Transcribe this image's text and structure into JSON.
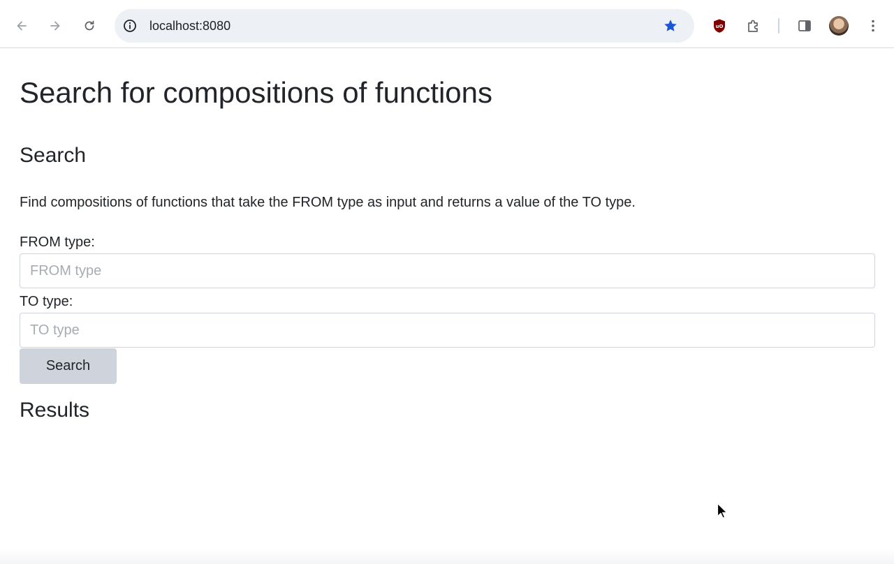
{
  "browser": {
    "url": "localhost:8080",
    "icons": {
      "back": "arrow-left-icon",
      "forward": "arrow-right-icon",
      "reload": "reload-icon",
      "site_info": "info-icon",
      "bookmark": "star-icon",
      "extension_ublock": "ublock-origin-icon",
      "extensions": "puzzle-piece-icon",
      "side_panel": "side-panel-icon",
      "menu": "kebab-menu-icon"
    },
    "colors": {
      "bookmark_star": "#1a57d6",
      "ublock": "#800000"
    }
  },
  "page": {
    "title": "Search for compositions of functions",
    "search_heading": "Search",
    "description": "Find compositions of functions that take the FROM type as input and returns a value of the TO type.",
    "from_label": "FROM type:",
    "from_placeholder": "FROM type",
    "from_value": "",
    "to_label": "TO type:",
    "to_placeholder": "TO type",
    "to_value": "",
    "search_button": "Search",
    "results_heading": "Results"
  }
}
